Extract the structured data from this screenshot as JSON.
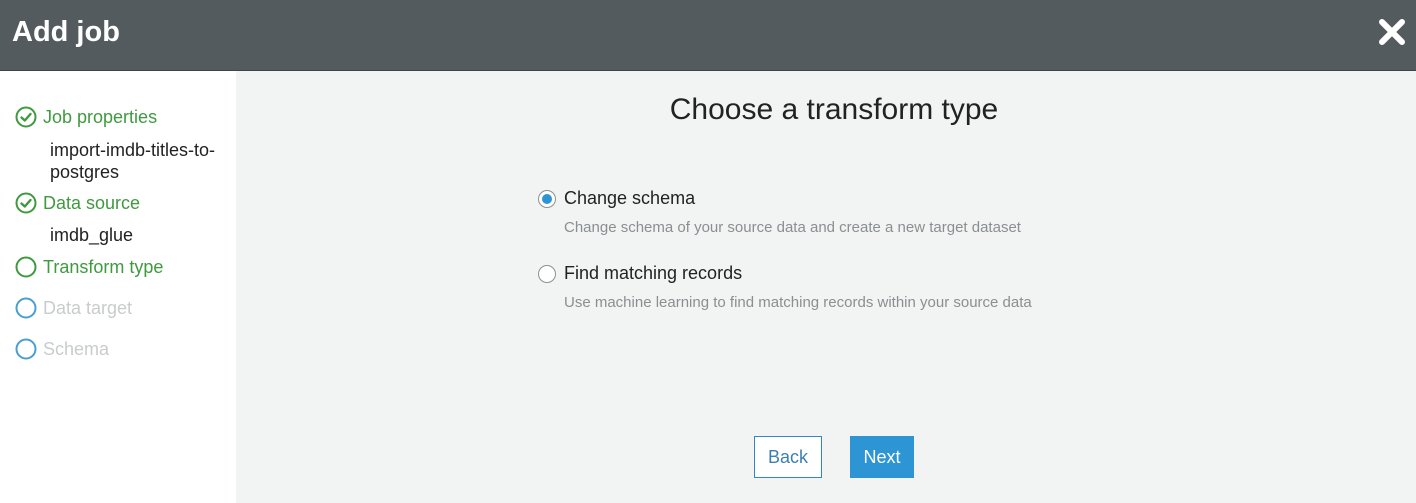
{
  "header": {
    "title": "Add job",
    "close_icon": "close-icon"
  },
  "colors": {
    "header_bg": "#545b5e",
    "step_done": "#3f9a3f",
    "step_todo_ring": "#4a9fd0",
    "step_todo_text": "#c9cccd",
    "primary": "#2e95d5"
  },
  "sidebar": {
    "steps": [
      {
        "label": "Job properties",
        "status": "done",
        "detail": "import-imdb-titles-to-postgres",
        "icon": "check-circle-icon"
      },
      {
        "label": "Data source",
        "status": "done",
        "detail": "imdb_glue",
        "icon": "check-circle-icon"
      },
      {
        "label": "Transform type",
        "status": "current",
        "icon": "circle-icon"
      },
      {
        "label": "Data target",
        "status": "todo",
        "icon": "circle-icon"
      },
      {
        "label": "Schema",
        "status": "todo",
        "icon": "circle-icon"
      }
    ]
  },
  "main": {
    "title": "Choose a transform type",
    "options": [
      {
        "label": "Change schema",
        "description": "Change schema of your source data and create a new target dataset",
        "selected": true
      },
      {
        "label": "Find matching records",
        "description": "Use machine learning to find matching records within your source data",
        "selected": false
      }
    ],
    "back_label": "Back",
    "next_label": "Next"
  }
}
